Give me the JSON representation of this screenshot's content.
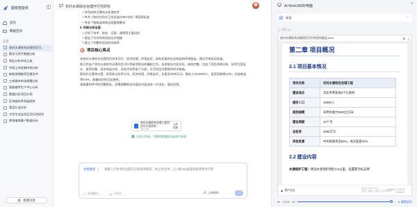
{
  "sidebar": {
    "app_name": "超级智能体",
    "nav": [
      {
        "label": "首页",
        "icon": "home-icon"
      },
      {
        "label": "数据空间",
        "icon": "folder-icon"
      }
    ],
    "history_title": "历史",
    "history": [
      {
        "label": "农村水源综合治理项目可行性研究",
        "active": true
      },
      {
        "label": "数学习采手数据分析"
      },
      {
        "label": "商业分析市场工具"
      },
      {
        "label": "中国上市金融市场分析"
      },
      {
        "label": "新能源储能项目建设书"
      },
      {
        "label": "三线城市市场规模分析"
      },
      {
        "label": "智能硬件生产中心分析"
      },
      {
        "label": "数据分析项目计划"
      },
      {
        "label": "区块链技术发展趋势"
      },
      {
        "label": "食品行业分析"
      },
      {
        "label": "大学生创业项目可行性研究"
      },
      {
        "label": "跨境电商客户数据分析"
      }
    ],
    "new_chat": "新建对话"
  },
  "main": {
    "title": "农村水源综合治理可行性研究",
    "lines_top": [
      "• 采用成熟可靠的水处理技术",
      "• 符合《农村饮用水卫生标准(GB5749)》等国家标准",
      "• 考虑了智能监测和远程管理需求"
    ],
    "section_risk": "5. 风险分析全面",
    "risk_bullets": [
      "• 识别了技术、财务、运营、政策等主要风险",
      "• 提出了针对性的风险应对措施",
      "• 建立了完整的风险防控体系"
    ],
    "core_heading": "项目核心亮点",
    "paragraphs": [
      "该农村水源综合治理项目技术可行、经济合理、环境友好，具有显著的社会效益和环境效益，建议尽快启动实施。",
      "我已完成了农村水源综合治理项目可行性研究报告的编制工作。这份报告内容详实，结构完整，包含了项目背景分析、技术方案设计、投资估算、经济效益分析、风险评估等各个方面，可为项目决策提供科学依据。",
      "报告的主要特点是：采用前沿技术方法，经济合理，环境友好，总投资2800万元，服务人口15000人，投资回收期12年，内部收益率8.5%，具备较好的可实施性。",
      "请查看附件中的完整报告。如需调整报告的某些内容或进一步深化，请告诉我。"
    ],
    "file": {
      "name": "农村水源综合治理工程项目可行性研究...",
      "size": "30.1 KB",
      "open": "立即查看"
    },
    "status": "任务已完成，可随时查看报告或进行修改",
    "input": {
      "tag": "文档模式",
      "placeholder": "请输入计划书的主题方向和具体需求，网上将文件，让AI和365超级智能体帮你写吧",
      "tool1": "文档模式",
      "tool2": "计划书",
      "upload": "上传附件"
    }
  },
  "panel": {
    "title": "AI Work365的电脑",
    "tab_label": "阅读",
    "file_label": "文件 (1)",
    "doc_filename": "农村水源综合治理项目可行性研究报告.html",
    "doc": {
      "h1": "第二章 项目概况",
      "h2": "2.1 项目基本情况",
      "table": [
        [
          "项目名称",
          "农村水源综合治理工程"
        ],
        [
          "建设地点",
          "华北平原某县8个行政村"
        ],
        [
          "服务人口",
          "15000人"
        ],
        [
          "规划规模",
          "日供水能力5000立方米"
        ],
        [
          "建设周期",
          "24个月"
        ],
        [
          "总投资",
          "2800万元"
        ],
        [
          "资金来源",
          "中央财政资金60%，地方配套40%"
        ]
      ],
      "h2b": "2.2 建设内容",
      "text_bold": "水源保护工程：",
      "text": "建设水源保护围栏3.5公里，设置警示标志牌"
    },
    "foot_user": "用户点击",
    "foot_time": [
      "2025/6/3 17:39:12",
      "2025/6/3"
    ],
    "watermark": [
      "激活 Windows",
      "转到\"设置\"以激活 Windows。"
    ],
    "player": {
      "page": "14/14",
      "live": "跟随实时",
      "progress": 0.96
    }
  }
}
